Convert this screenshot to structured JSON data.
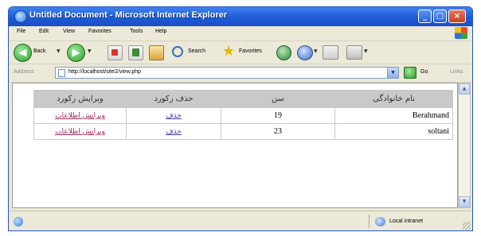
{
  "window": {
    "title": "Untitled Document - Microsoft Internet Explorer",
    "minimize_glyph": "_",
    "maximize_glyph": "□",
    "close_glyph": "×"
  },
  "menu": {
    "items": [
      "File",
      "Edit",
      "View",
      "Favorites",
      "Tools",
      "Help"
    ]
  },
  "toolbar": {
    "back_label": "Back",
    "search_label": "Search",
    "favorites_label": "Favorites",
    "back_arrow": "◀",
    "forward_arrow": "▶",
    "dropdown_glyph": "▼",
    "star_glyph": "★"
  },
  "address": {
    "label": "Address",
    "url": "http://localhost/site2/view.php",
    "go_label": "Go",
    "links_label": "Links"
  },
  "table": {
    "headers": {
      "name": "نام خانوادگی",
      "age": "سن",
      "delete": "حذف رکورد",
      "edit": "ویرایش رکورد"
    },
    "rows": [
      {
        "name": "Berahmand",
        "age": "19",
        "delete_link": "حذف",
        "edit_link": "ویرایش اطلاعات"
      },
      {
        "name": "soltani",
        "age": "23",
        "delete_link": "حذف",
        "edit_link": "ویرایش اطلاعات"
      }
    ]
  },
  "status": {
    "zone": "Local intranet"
  },
  "colors": {
    "titlebar": "#1f5ad6",
    "header_bg": "#c9c9c9",
    "link": "#3a3aa8",
    "edit_link": "#a0285a"
  },
  "icons": {
    "app": "ie-icon",
    "windows_logo": "windows-logo-icon"
  }
}
